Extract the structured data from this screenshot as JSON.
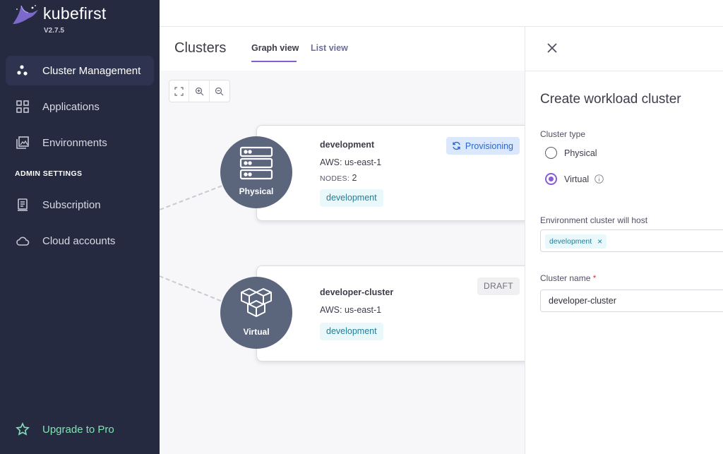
{
  "brand": {
    "name": "kubefirst",
    "version": "V2.7.5"
  },
  "sidebar": {
    "items": [
      {
        "label": "Cluster Management",
        "icon": "cluster-icon",
        "active": true
      },
      {
        "label": "Applications",
        "icon": "grid-icon"
      },
      {
        "label": "Environments",
        "icon": "environments-icon"
      }
    ],
    "admin_label": "ADMIN SETTINGS",
    "admin_items": [
      {
        "label": "Subscription",
        "icon": "subscription-icon"
      },
      {
        "label": "Cloud accounts",
        "icon": "cloud-icon"
      }
    ],
    "upgrade_label": "Upgrade to Pro"
  },
  "header": {
    "title": "Clusters",
    "tabs": [
      {
        "label": "Graph view",
        "active": true
      },
      {
        "label": "List view"
      }
    ]
  },
  "graph": {
    "nodes": [
      {
        "type_label": "Physical",
        "name": "development",
        "provider": "AWS: us-east-1",
        "nodes_label": "NODES:",
        "nodes_count": "2",
        "tag": "development",
        "status": "Provisioning"
      },
      {
        "type_label": "Virtual",
        "name": "developer-cluster",
        "provider": "AWS: us-east-1",
        "tag": "development",
        "status": "DRAFT"
      }
    ]
  },
  "panel": {
    "title": "Create workload cluster",
    "cluster_type_label": "Cluster type",
    "options": [
      {
        "label": "Physical",
        "checked": false
      },
      {
        "label": "Virtual",
        "checked": true
      }
    ],
    "environment_label": "Environment cluster will host",
    "environment_chip": "development",
    "cluster_name_label": "Cluster name",
    "required_mark": "*",
    "cluster_name_value": "developer-cluster"
  },
  "colors": {
    "sidebar_bg": "#252a41",
    "accent_purple": "#8a5bd6",
    "upgrade_green": "#81e2b4",
    "node_circle": "#5b667d",
    "tag_bg": "#e8f8fb",
    "tag_text": "#237d96",
    "provisioning_bg": "#dbe8fc",
    "provisioning_text": "#2f66c6"
  }
}
